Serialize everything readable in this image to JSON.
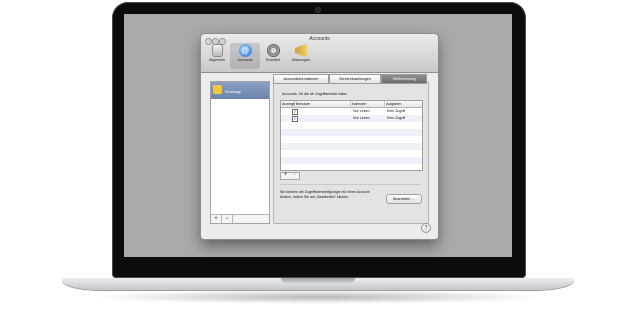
{
  "window": {
    "title": "Accounts"
  },
  "toolbar": {
    "items": [
      {
        "label": "Allgemein",
        "icon": "switch-icon"
      },
      {
        "label": "Accounts",
        "icon": "at-sign-icon"
      },
      {
        "label": "Erweitert",
        "icon": "gear-icon"
      },
      {
        "label": "Warnungen",
        "icon": "megaphone-icon"
      }
    ],
    "selected": "Accounts"
  },
  "sidebar": {
    "account": {
      "name": "",
      "type": "Exchange"
    },
    "add_label": "+",
    "remove_label": "−"
  },
  "tabs": [
    {
      "label": "Accountinformationen"
    },
    {
      "label": "Servereinstellungen"
    },
    {
      "label": "Stellvertretung",
      "active": true
    }
  ],
  "panel": {
    "heading": "Accounts, für die ich Zugriffsrechte habe:",
    "columns": [
      "Anzeigen",
      "Benutzer",
      "Kalender",
      "Aufgaben"
    ],
    "rows": [
      {
        "checked": "✓",
        "user": "",
        "calendar": "Nur Lesen",
        "tasks": "Kein Zugriff"
      },
      {
        "checked": "✓",
        "user": "",
        "calendar": "Nur Lesen",
        "tasks": "Kein Zugriff"
      }
    ],
    "add_label": "+",
    "remove_label": "−",
    "note": "Sie können die Zugriffsberechtigungen für Ihren Account ändern, indem Sie auf „Bearbeiten“ klicken.",
    "edit_button": "Bearbeiten …"
  },
  "help_label": "?",
  "colors": {
    "selection": "#7089b3",
    "screen_background": "#a9a9a9"
  }
}
